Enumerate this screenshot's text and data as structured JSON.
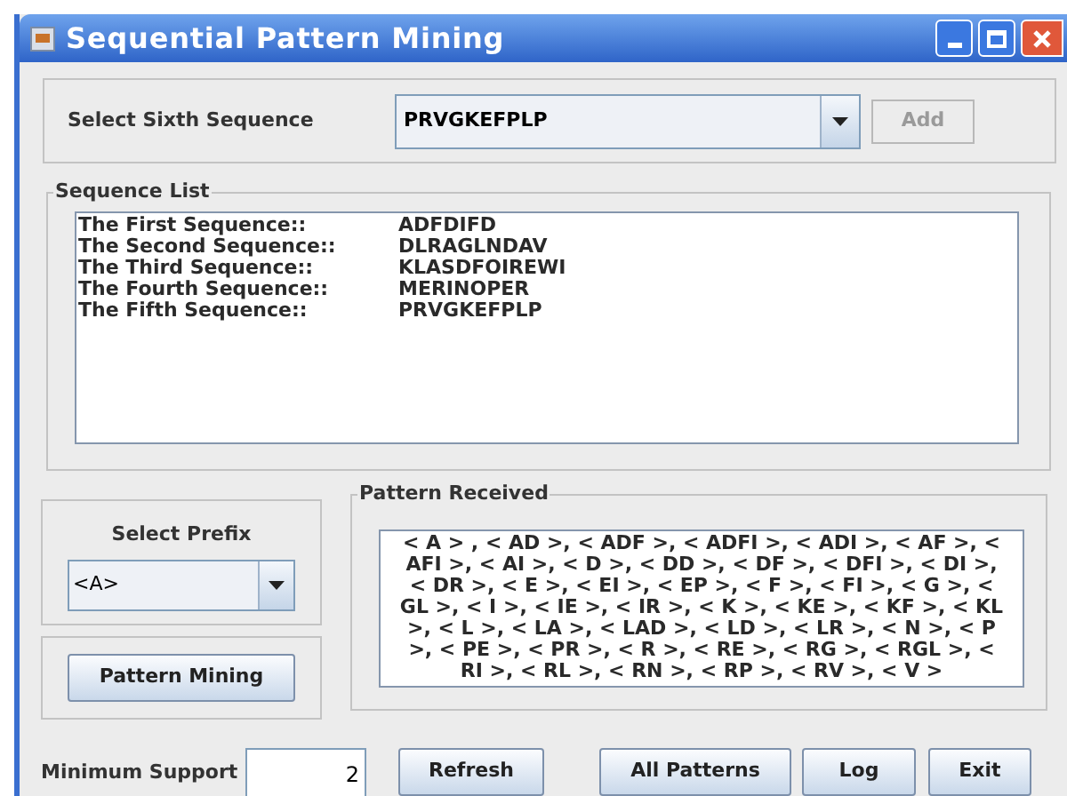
{
  "window": {
    "title": "Sequential Pattern Mining"
  },
  "sixth_sequence": {
    "label": "Select Sixth Sequence",
    "value": "PRVGKEFPLP",
    "add_button": {
      "label": "Add",
      "disabled": true
    }
  },
  "sequence_list": {
    "title": "Sequence List",
    "rows": [
      {
        "name": "The First Sequence::",
        "sequence": "ADFDIFD"
      },
      {
        "name": "The Second Sequence::",
        "sequence": "DLRAGLNDAV"
      },
      {
        "name": "The Third Sequence::",
        "sequence": "KLASDFOIREWI"
      },
      {
        "name": "The Fourth Sequence::",
        "sequence": "MERINOPER"
      },
      {
        "name": "The Fifth Sequence::",
        "sequence": "PRVGKEFPLP"
      }
    ]
  },
  "prefix": {
    "label": "Select Prefix",
    "value": "<A>"
  },
  "pattern_mining_button": "Pattern Mining",
  "pattern_received": {
    "title": "Pattern Received",
    "lines": [
      "< A > , < AD >, < ADF >, < ADFI >, < ADI >, < AF >, <",
      "AFI >, < AI >, < D >, < DD >, < DF >, < DFI >, < DI >,",
      "< DR >, < E >, < EI >, < EP >, < F >, < FI >, < G >, <",
      "GL >, < I >, < IE >, < IR >, < K >, < KE >, < KF >, < KL",
      ">, < L >, < LA >, < LAD >, < LD >, < LR >, < N >, < P",
      ">, < PE >, < PR >, < R >, < RE >, < RG >, < RGL >, <",
      "RI >, < RL >, < RN >, < RP >, < RV >, < V >"
    ]
  },
  "minimum_support": {
    "label": "Minimum Support",
    "value": "2"
  },
  "buttons": [
    "Refresh",
    "All Patterns",
    "Log",
    "Exit"
  ]
}
